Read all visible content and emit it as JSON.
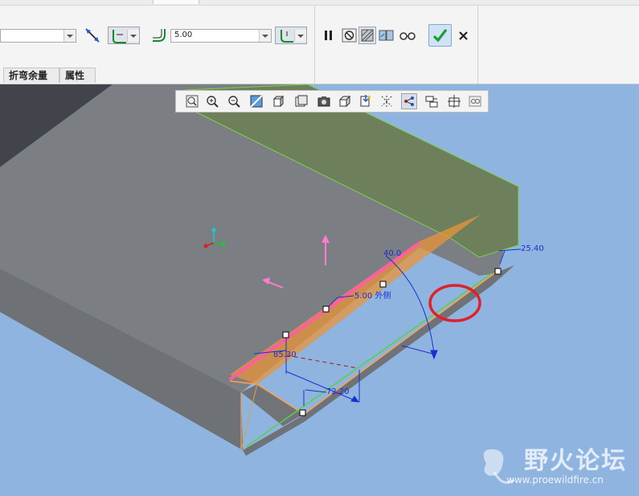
{
  "dashboard": {
    "thickness_value": "5.00",
    "tabs": [
      "折弯余量",
      "属性"
    ],
    "buttons": {
      "pause": "pause-icon",
      "stop": "stop-icon",
      "preview_a": "preview-icon",
      "preview_b": "verify-icon",
      "glasses": "glasses-icon",
      "apply": "apply-check-icon",
      "cancel": "cancel-x-icon"
    }
  },
  "view_toolbar": {
    "icons": [
      "refit-icon",
      "zoom-in-icon",
      "zoom-out-icon",
      "repaint-icon",
      "shading-icon",
      "view-manager-icon",
      "saved-views-icon",
      "orient-icon",
      "datum-planes-icon",
      "datum-axes-icon",
      "datum-points-icon",
      "csys-icon",
      "annotation-icon",
      "spin-center-icon"
    ]
  },
  "model": {
    "dimensions": {
      "angle": "40.0",
      "radius": "5.00 外侧",
      "width": "85.30",
      "offset_left": "72.20",
      "offset_right": "25.40"
    },
    "colors": {
      "dim": "#1a2fd0",
      "flange": "#e8943a",
      "edge": "#ff5fa0",
      "wall": "#6e7f5c",
      "highlight": "#e0202a"
    }
  },
  "watermark": {
    "title": "野火论坛",
    "url": "www.proewildfire.cn"
  }
}
